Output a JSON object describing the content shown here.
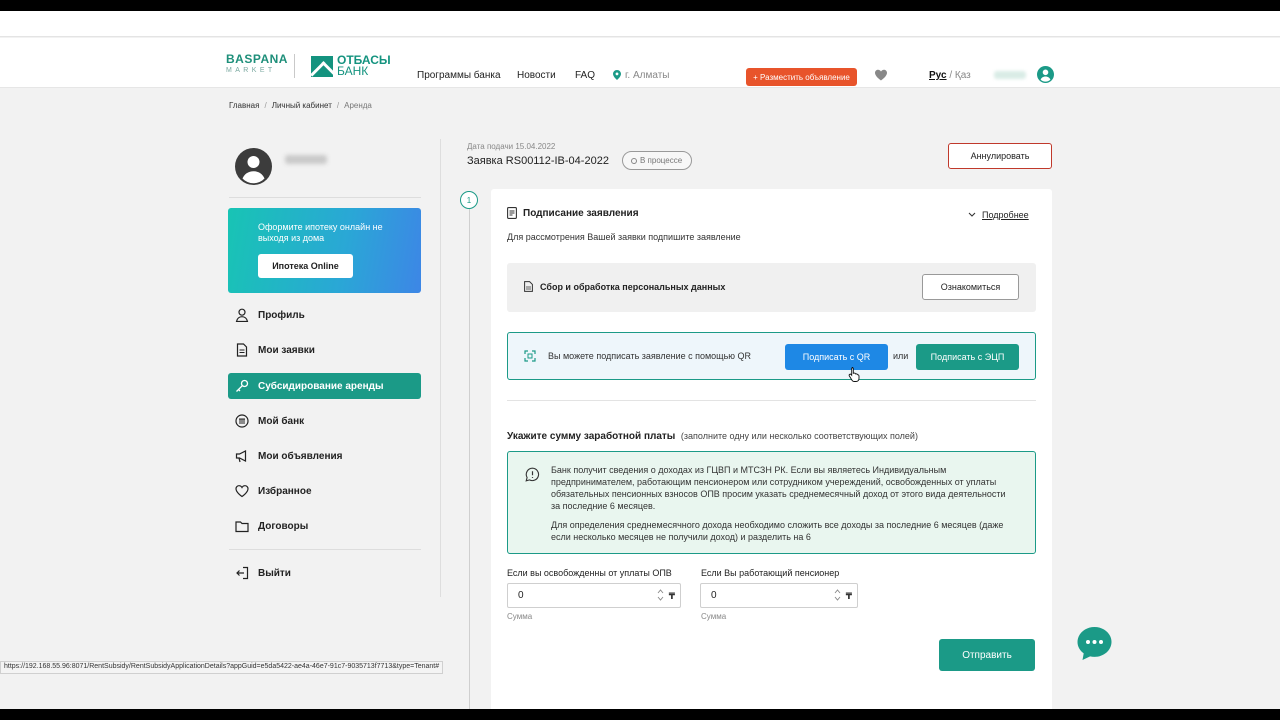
{
  "header": {
    "logo_primary": "BASPANA",
    "logo_secondary": "MARKET",
    "bank_logo_line1": "ОТБАСЫ",
    "bank_logo_line2": "БАНК",
    "nav": [
      "Программы банка",
      "Новости",
      "FAQ"
    ],
    "city": "г. Алматы",
    "post_button": "+ Разместить объявление",
    "lang_active": "Рус",
    "lang_sep": " / ",
    "lang_other": "Қаз"
  },
  "breadcrumbs": [
    "Главная",
    "Личный кабинет",
    "Аренда"
  ],
  "sidebar": {
    "promo_text": "Оформите ипотеку онлайн не выходя из дома",
    "promo_button": "Ипотека Online",
    "items": [
      {
        "label": "Профиль",
        "icon": "user-icon"
      },
      {
        "label": "Мои заявки",
        "icon": "document-icon"
      },
      {
        "label": "Субсидирование аренды",
        "icon": "key-icon",
        "active": true
      },
      {
        "label": "Мой банк",
        "icon": "bank-icon"
      },
      {
        "label": "Мои объявления",
        "icon": "megaphone-icon"
      },
      {
        "label": "Избранное",
        "icon": "heart-icon"
      },
      {
        "label": "Договоры",
        "icon": "folder-icon"
      }
    ],
    "logout": "Выйти"
  },
  "application": {
    "date": "Дата подачи 15.04.2022",
    "title": "Заявка RS00112-IB-04-2022",
    "status": "В процессе",
    "cancel_button": "Аннулировать",
    "step": "1"
  },
  "signing": {
    "title": "Подписание заявления",
    "more": "Подробнее",
    "subtitle": "Для рассмотрения Вашей заявки подпишите заявление",
    "personal_data": "Сбор и обработка персональных данных",
    "read_button": "Ознакомиться",
    "qr_text": "Вы можете подписать заявление с помощью QR",
    "qr_button": "Подписать с QR",
    "or": "или",
    "ecp_button": "Подписать с ЭЦП"
  },
  "salary": {
    "title": "Укажите сумму заработной платы",
    "hint": "(заполните одну или несколько соответствующих полей)",
    "info_p1": "Банк получит сведения о доходах из ГЦВП и МТСЗН РК. Если вы являетесь Индивидуальным предпринимателем, работающим пенсионером или сотрудником учереждений, освобожденных от уплаты обязательных пенсионных взносов ОПВ просим указать среднемесячный доход от этого вида деятельности за последние 6 месяцев.",
    "info_p2": "Для определения среднемесячного дохода необходимо сложить все доходы за последние 6 месяцев (даже если несколько месяцев не получили доход) и разделить на 6",
    "field1_label": "Если вы освобожденны от уплаты ОПВ",
    "field1_value": "0",
    "field2_label": "Если Вы работающий пенсионер",
    "field2_value": "0",
    "sum_hint": "Сумма",
    "currency": "₸",
    "submit": "Отправить"
  },
  "status_url": "https://192.168.55.96:8071/RentSubsidy/RentSubsidyApplicationDetails?appGuid=e5da5422-ae4a-46e7-91c7-9035713f7713&type=Tenant#",
  "colors": {
    "accent": "#1b9a87",
    "qr_blue": "#1e88e5",
    "post_orange": "#e8542b"
  }
}
